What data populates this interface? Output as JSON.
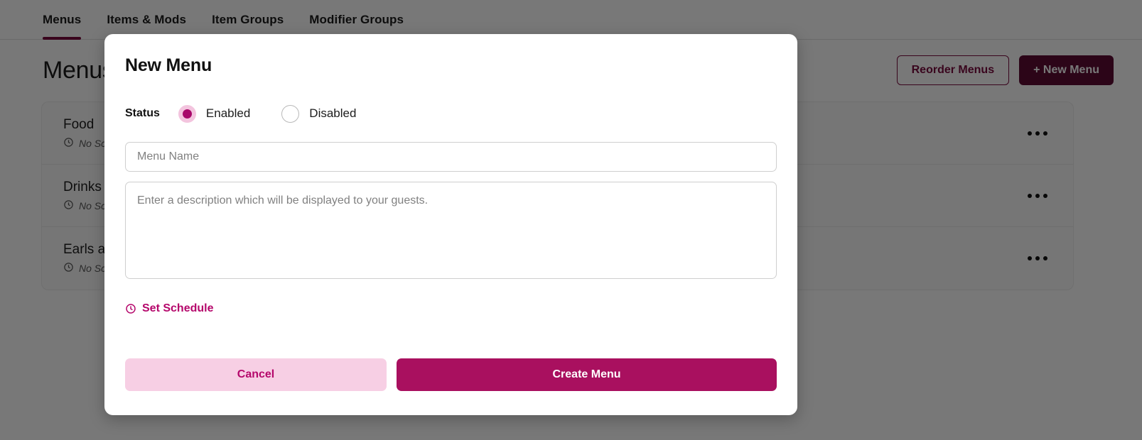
{
  "theme": {
    "brand_magenta": "#b5076b",
    "brand_dark": "#7a0b3f",
    "brand_darkest": "#5e0b33",
    "brand_light_pink": "#f7cfe4",
    "radio_halo": "#f3c4de",
    "radio_dot": "#a8076a",
    "create_button_bg": "#a9105f"
  },
  "tabs": [
    {
      "label": "Menus",
      "active": true
    },
    {
      "label": "Items & Mods",
      "active": false
    },
    {
      "label": "Item Groups",
      "active": false
    },
    {
      "label": "Modifier Groups",
      "active": false
    }
  ],
  "page": {
    "title": "Menus",
    "reorder_button": "Reorder Menus",
    "new_menu_button": "+ New Menu",
    "rows": [
      {
        "name": "Food",
        "schedule": "No Schedule",
        "clock_icon": "clock-icon",
        "overflow_icon": "ellipsis-icon"
      },
      {
        "name": "Drinks",
        "schedule": "No Schedule",
        "clock_icon": "clock-icon",
        "overflow_icon": "ellipsis-icon"
      },
      {
        "name": "Earls at Home",
        "schedule": "No Schedule",
        "clock_icon": "clock-icon",
        "overflow_icon": "ellipsis-icon"
      }
    ]
  },
  "modal": {
    "title": "New Menu",
    "status": {
      "label": "Status",
      "options": [
        {
          "label": "Enabled",
          "selected": true
        },
        {
          "label": "Disabled",
          "selected": false
        }
      ]
    },
    "name_field": {
      "value": "",
      "placeholder": "Menu Name"
    },
    "description_field": {
      "value": "",
      "placeholder": "Enter a description which will be displayed to your guests."
    },
    "schedule_link": {
      "label": "Set Schedule",
      "icon": "clock-icon"
    },
    "cancel_button": "Cancel",
    "create_button": "Create Menu"
  }
}
